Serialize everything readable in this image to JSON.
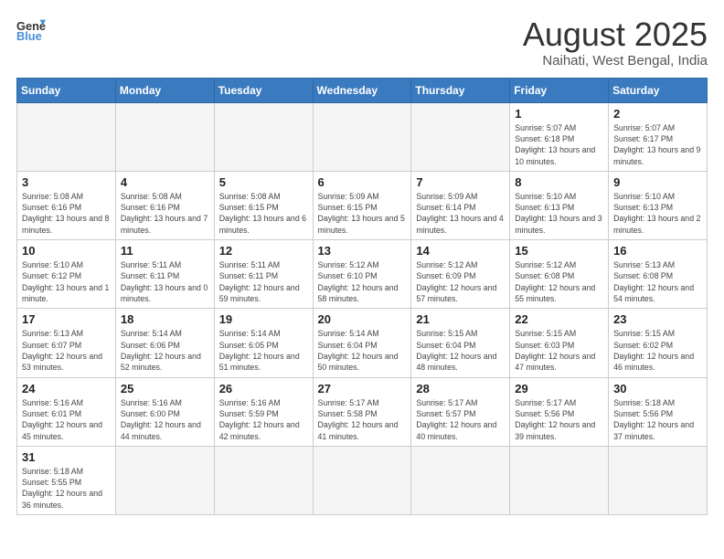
{
  "logo": {
    "general": "General",
    "blue": "Blue"
  },
  "title": "August 2025",
  "subtitle": "Naihati, West Bengal, India",
  "weekdays": [
    "Sunday",
    "Monday",
    "Tuesday",
    "Wednesday",
    "Thursday",
    "Friday",
    "Saturday"
  ],
  "weeks": [
    [
      {
        "day": "",
        "info": ""
      },
      {
        "day": "",
        "info": ""
      },
      {
        "day": "",
        "info": ""
      },
      {
        "day": "",
        "info": ""
      },
      {
        "day": "",
        "info": ""
      },
      {
        "day": "1",
        "info": "Sunrise: 5:07 AM\nSunset: 6:18 PM\nDaylight: 13 hours\nand 10 minutes."
      },
      {
        "day": "2",
        "info": "Sunrise: 5:07 AM\nSunset: 6:17 PM\nDaylight: 13 hours\nand 9 minutes."
      }
    ],
    [
      {
        "day": "3",
        "info": "Sunrise: 5:08 AM\nSunset: 6:16 PM\nDaylight: 13 hours\nand 8 minutes."
      },
      {
        "day": "4",
        "info": "Sunrise: 5:08 AM\nSunset: 6:16 PM\nDaylight: 13 hours\nand 7 minutes."
      },
      {
        "day": "5",
        "info": "Sunrise: 5:08 AM\nSunset: 6:15 PM\nDaylight: 13 hours\nand 6 minutes."
      },
      {
        "day": "6",
        "info": "Sunrise: 5:09 AM\nSunset: 6:15 PM\nDaylight: 13 hours\nand 5 minutes."
      },
      {
        "day": "7",
        "info": "Sunrise: 5:09 AM\nSunset: 6:14 PM\nDaylight: 13 hours\nand 4 minutes."
      },
      {
        "day": "8",
        "info": "Sunrise: 5:10 AM\nSunset: 6:13 PM\nDaylight: 13 hours\nand 3 minutes."
      },
      {
        "day": "9",
        "info": "Sunrise: 5:10 AM\nSunset: 6:13 PM\nDaylight: 13 hours\nand 2 minutes."
      }
    ],
    [
      {
        "day": "10",
        "info": "Sunrise: 5:10 AM\nSunset: 6:12 PM\nDaylight: 13 hours\nand 1 minute."
      },
      {
        "day": "11",
        "info": "Sunrise: 5:11 AM\nSunset: 6:11 PM\nDaylight: 13 hours\nand 0 minutes."
      },
      {
        "day": "12",
        "info": "Sunrise: 5:11 AM\nSunset: 6:11 PM\nDaylight: 12 hours\nand 59 minutes."
      },
      {
        "day": "13",
        "info": "Sunrise: 5:12 AM\nSunset: 6:10 PM\nDaylight: 12 hours\nand 58 minutes."
      },
      {
        "day": "14",
        "info": "Sunrise: 5:12 AM\nSunset: 6:09 PM\nDaylight: 12 hours\nand 57 minutes."
      },
      {
        "day": "15",
        "info": "Sunrise: 5:12 AM\nSunset: 6:08 PM\nDaylight: 12 hours\nand 55 minutes."
      },
      {
        "day": "16",
        "info": "Sunrise: 5:13 AM\nSunset: 6:08 PM\nDaylight: 12 hours\nand 54 minutes."
      }
    ],
    [
      {
        "day": "17",
        "info": "Sunrise: 5:13 AM\nSunset: 6:07 PM\nDaylight: 12 hours\nand 53 minutes."
      },
      {
        "day": "18",
        "info": "Sunrise: 5:14 AM\nSunset: 6:06 PM\nDaylight: 12 hours\nand 52 minutes."
      },
      {
        "day": "19",
        "info": "Sunrise: 5:14 AM\nSunset: 6:05 PM\nDaylight: 12 hours\nand 51 minutes."
      },
      {
        "day": "20",
        "info": "Sunrise: 5:14 AM\nSunset: 6:04 PM\nDaylight: 12 hours\nand 50 minutes."
      },
      {
        "day": "21",
        "info": "Sunrise: 5:15 AM\nSunset: 6:04 PM\nDaylight: 12 hours\nand 48 minutes."
      },
      {
        "day": "22",
        "info": "Sunrise: 5:15 AM\nSunset: 6:03 PM\nDaylight: 12 hours\nand 47 minutes."
      },
      {
        "day": "23",
        "info": "Sunrise: 5:15 AM\nSunset: 6:02 PM\nDaylight: 12 hours\nand 46 minutes."
      }
    ],
    [
      {
        "day": "24",
        "info": "Sunrise: 5:16 AM\nSunset: 6:01 PM\nDaylight: 12 hours\nand 45 minutes."
      },
      {
        "day": "25",
        "info": "Sunrise: 5:16 AM\nSunset: 6:00 PM\nDaylight: 12 hours\nand 44 minutes."
      },
      {
        "day": "26",
        "info": "Sunrise: 5:16 AM\nSunset: 5:59 PM\nDaylight: 12 hours\nand 42 minutes."
      },
      {
        "day": "27",
        "info": "Sunrise: 5:17 AM\nSunset: 5:58 PM\nDaylight: 12 hours\nand 41 minutes."
      },
      {
        "day": "28",
        "info": "Sunrise: 5:17 AM\nSunset: 5:57 PM\nDaylight: 12 hours\nand 40 minutes."
      },
      {
        "day": "29",
        "info": "Sunrise: 5:17 AM\nSunset: 5:56 PM\nDaylight: 12 hours\nand 39 minutes."
      },
      {
        "day": "30",
        "info": "Sunrise: 5:18 AM\nSunset: 5:56 PM\nDaylight: 12 hours\nand 37 minutes."
      }
    ],
    [
      {
        "day": "31",
        "info": "Sunrise: 5:18 AM\nSunset: 5:55 PM\nDaylight: 12 hours\nand 36 minutes."
      },
      {
        "day": "",
        "info": ""
      },
      {
        "day": "",
        "info": ""
      },
      {
        "day": "",
        "info": ""
      },
      {
        "day": "",
        "info": ""
      },
      {
        "day": "",
        "info": ""
      },
      {
        "day": "",
        "info": ""
      }
    ]
  ]
}
